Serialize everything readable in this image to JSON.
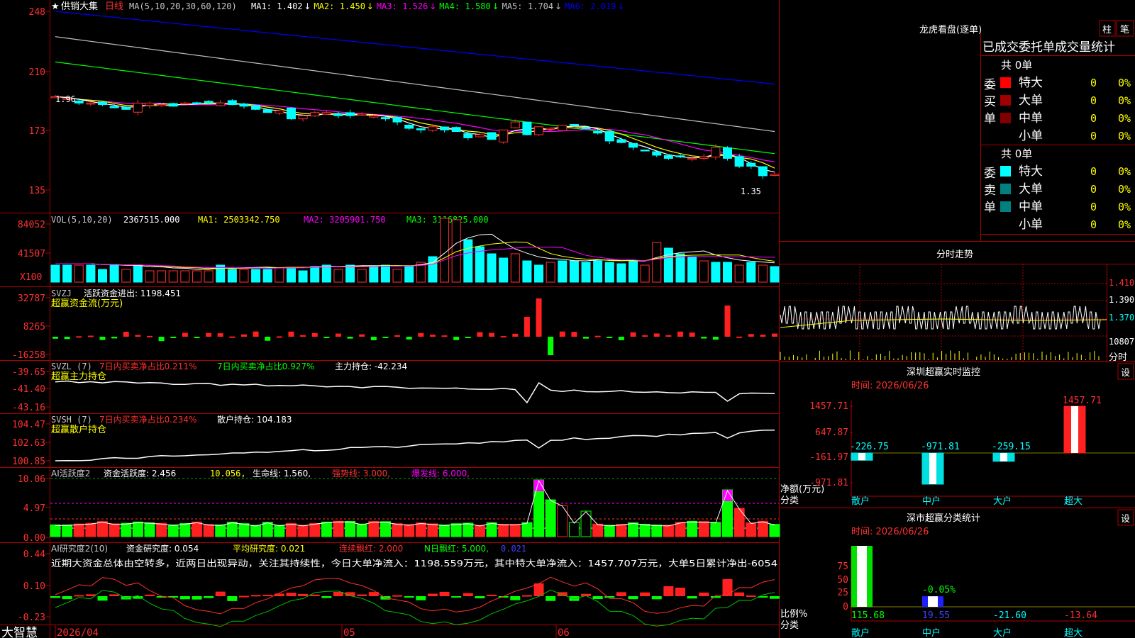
{
  "app": {
    "brand": "大智慧"
  },
  "stock": {
    "star": "★",
    "name": "供销大集",
    "period": "日线"
  },
  "price_panel": {
    "ma_header": "MA(5,10,20,30,60,120)",
    "ma_items": [
      {
        "label": "MA1:",
        "value": "1.402",
        "arrow": "↓",
        "color": "#ffffff"
      },
      {
        "label": "MA2:",
        "value": "1.450",
        "arrow": "↓",
        "color": "#ffff00"
      },
      {
        "label": "MA3:",
        "value": "1.526",
        "arrow": "↓",
        "color": "#ff00ff"
      },
      {
        "label": "MA4:",
        "value": "1.580",
        "arrow": "↓",
        "color": "#00ff00"
      },
      {
        "label": "MA5:",
        "value": "1.704",
        "arrow": "↓",
        "color": "#c0c0c0"
      },
      {
        "label": "MA6:",
        "value": "2.019",
        "arrow": "↓",
        "color": "#0000ff"
      }
    ],
    "y_ticks": [
      "248",
      "210",
      "173",
      "135"
    ],
    "high_mark": "1.96",
    "low_mark": "1.35"
  },
  "vol_panel": {
    "header": "VOL(5,10,20)",
    "value": "2367515.000",
    "ma1": "MA1: 2503342.750",
    "ma2": "MA2: 3205901.750",
    "ma3": "MA3: 3116825.000",
    "y_ticks": [
      "84052",
      "41507"
    ],
    "unit": "X100"
  },
  "svzj_panel": {
    "line1_name": "SVZJ",
    "line1_label": "活跃资金进出: 1198.451",
    "line2": "超赢资金流(万元)",
    "y_ticks": [
      "32787",
      "8265",
      "-16258"
    ]
  },
  "svzl_panel": {
    "name": "SVZL (7)",
    "red_text": "7日内买卖净占比0.211%",
    "green_text": "7日内买卖净占比0.927%",
    "label": "主力持仓: -42.234",
    "line2": "超赢主力持仓",
    "y_ticks": [
      "-39.65",
      "-41.40",
      "-43.16"
    ]
  },
  "svsh_panel": {
    "name": "SVSH (7)",
    "red_text": "7日内买卖净占比0.234%",
    "label": "散户持仓: 104.183",
    "line2": "超赢散户持仓",
    "y_ticks": [
      "104.47",
      "102.63",
      "100.85"
    ]
  },
  "ai_panel": {
    "name": "AI活跃度2",
    "label1": "资金活跃度: 2.456",
    "label2": "10.056,",
    "label3": "生命线: 1.560,",
    "label4": "强势线: 3.000,",
    "label5": "爆发线: 6.000,",
    "y_ticks": [
      "10.06",
      "4.97",
      "0.00"
    ]
  },
  "research_panel": {
    "name": "AI研究度2(10)",
    "label1": "资金研究度: 0.054",
    "label2": "平均研究度: 0.021",
    "label3": "连续飘红: 2.000",
    "label4": "N日飘红: 5.000,",
    "label5": "0.021",
    "commentary": "近期大资金总体由空转多，近两日出现异动，关注其持续性，今日大单净流入：1198.559万元，其中特大单净流入：1457.707万元，大单5日累计净出-6054",
    "y_ticks": [
      "0.44",
      "0.10",
      "-0.23"
    ]
  },
  "x_axis": {
    "labels": [
      "2026/04",
      "05",
      "06"
    ]
  },
  "right": {
    "lhb": {
      "title": "龙虎看盘(逐单)",
      "tab1": "柱",
      "tab2": "笔"
    },
    "order_stats": {
      "title": "已成交委托单成交量统计",
      "buy_header": "共 0单",
      "buy_side": "委买单",
      "sell_header": "共 0单",
      "sell_side": "委卖单",
      "buy_rows": [
        {
          "label": "特大",
          "count": "0",
          "pct": "0%",
          "color": "#ff0000"
        },
        {
          "label": "大单",
          "count": "0",
          "pct": "0%",
          "color": "#a00000"
        },
        {
          "label": "中单",
          "count": "0",
          "pct": "0%",
          "color": "#800000"
        },
        {
          "label": "小单",
          "count": "0",
          "pct": "0%",
          "color": "#000000"
        }
      ],
      "sell_rows": [
        {
          "label": "特大",
          "count": "0",
          "pct": "0%",
          "color": "#00ffff"
        },
        {
          "label": "大单",
          "count": "0",
          "pct": "0%",
          "color": "#008080"
        },
        {
          "label": "中单",
          "count": "0",
          "pct": "0%",
          "color": "#008080"
        },
        {
          "label": "小单",
          "count": "0",
          "pct": "0%",
          "color": "#000000"
        }
      ]
    },
    "intraday": {
      "title": "分时走势",
      "ticks": [
        "1.410",
        "1.390",
        "1.370",
        "10807"
      ],
      "footer": "分时"
    },
    "sz_monitor": {
      "title": "深圳超赢实时监控",
      "set": "设",
      "time": "时间: 2026/06/26",
      "y_ticks": [
        "1457.71",
        "647.87",
        "-161.97",
        "-971.81"
      ],
      "ylabel1": "净额(万元)",
      "ylabel2": "分类",
      "categories": [
        "散户",
        "中户",
        "大户",
        "超大"
      ],
      "values": [
        -226.75,
        -971.81,
        -259.15,
        1457.71
      ],
      "value_labels": [
        "-226.75",
        "-971.81",
        "-259.15",
        "1457.71"
      ]
    },
    "sz_class": {
      "title": "深市超赢分类统计",
      "set": "设",
      "time": "时间: 2026/06/26",
      "y_ticks": [
        "75",
        "50",
        "25",
        "0"
      ],
      "ylabel1": "比例%",
      "ylabel2": "分类",
      "categories": [
        "散户",
        "中户",
        "大户",
        "超大"
      ],
      "values": [
        115.68,
        19.55,
        -21.6,
        -13.64
      ],
      "value_labels": [
        "115.68",
        "19.55",
        "-21.60",
        "-13.64"
      ],
      "bar_note": "-0.05%"
    }
  },
  "chart_data": [
    {
      "type": "candlestick",
      "title": "供销大集 日线",
      "x": [
        "2026/04",
        "05",
        "06"
      ],
      "ylim": [
        1.35,
        2.48
      ],
      "series": [
        {
          "name": "MA1",
          "values": [
            1.402
          ]
        },
        {
          "name": "MA2",
          "values": [
            1.45
          ]
        },
        {
          "name": "MA3",
          "values": [
            1.526
          ]
        },
        {
          "name": "MA4",
          "values": [
            1.58
          ]
        },
        {
          "name": "MA5",
          "values": [
            1.704
          ]
        },
        {
          "name": "MA6",
          "values": [
            2.019
          ]
        }
      ]
    },
    {
      "type": "bar",
      "title": "深圳超赢实时监控",
      "categories": [
        "散户",
        "中户",
        "大户",
        "超大"
      ],
      "values": [
        -226.75,
        -971.81,
        -259.15,
        1457.71
      ],
      "ylabel": "净额(万元)"
    },
    {
      "type": "bar",
      "title": "深市超赢分类统计",
      "categories": [
        "散户",
        "中户",
        "大户",
        "超大"
      ],
      "values": [
        115.68,
        19.55,
        -21.6,
        -13.64
      ],
      "ylabel": "比例%"
    }
  ]
}
